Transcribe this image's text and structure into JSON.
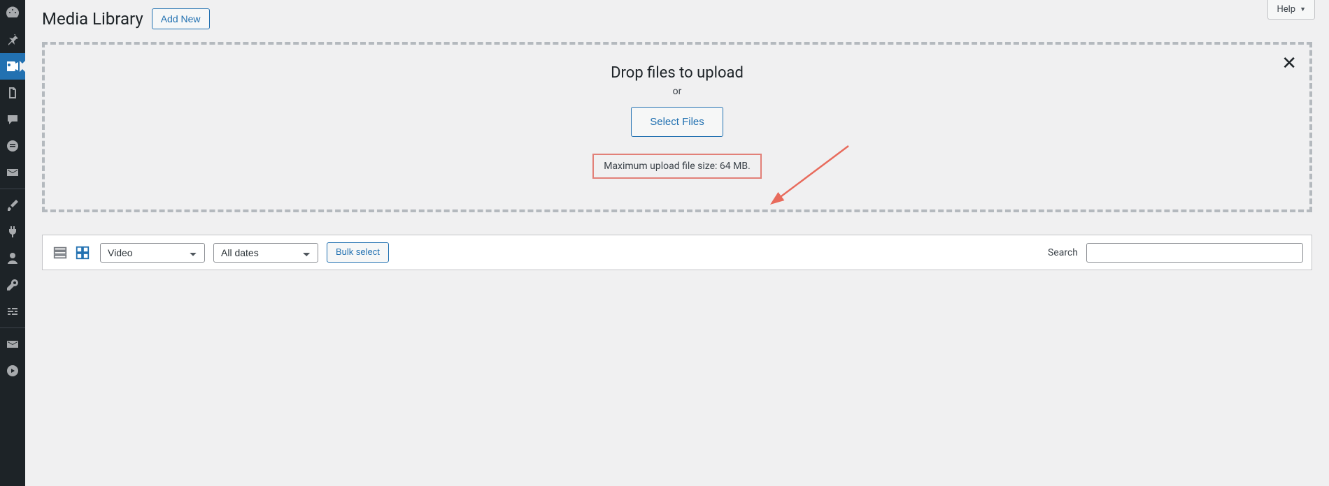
{
  "header": {
    "title": "Media Library",
    "add_new": "Add New",
    "help": "Help"
  },
  "dropzone": {
    "title": "Drop files to upload",
    "or": "or",
    "select_files": "Select Files",
    "max_upload": "Maximum upload file size: 64 MB."
  },
  "toolbar": {
    "media_type_selected": "Video",
    "date_selected": "All dates",
    "bulk_select": "Bulk select",
    "search_label": "Search"
  },
  "sidebar": {
    "items": [
      {
        "name": "dashboard"
      },
      {
        "name": "posts"
      },
      {
        "name": "media",
        "current": true
      },
      {
        "name": "pages"
      },
      {
        "name": "comments"
      },
      {
        "name": "custom-content"
      },
      {
        "name": "mail"
      },
      {
        "name": "appearance"
      },
      {
        "name": "plugins"
      },
      {
        "name": "users"
      },
      {
        "name": "tools"
      },
      {
        "name": "settings"
      },
      {
        "name": "email2"
      },
      {
        "name": "videos"
      }
    ]
  }
}
